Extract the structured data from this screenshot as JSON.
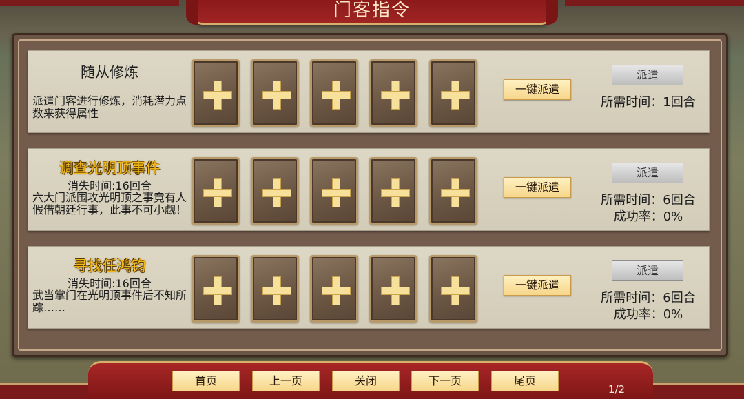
{
  "header": {
    "title": "门客指令"
  },
  "missions": [
    {
      "title": "随从修炼",
      "vanish_time": "",
      "description": "派遣门客进行修炼，消耗潜力点数来获得属性",
      "auto_dispatch_label": "一键派遣",
      "dispatch_label": "派遣",
      "required_time": "所需时间：1回合",
      "success_rate": ""
    },
    {
      "title": "调查光明顶事件",
      "vanish_time": "消失时间:16回合",
      "description": "六大门派围攻光明顶之事竟有人假借朝廷行事，此事不可小觑！",
      "auto_dispatch_label": "一键派遣",
      "dispatch_label": "派遣",
      "required_time": "所需时间：6回合",
      "success_rate": "成功率：0%"
    },
    {
      "title": "寻找任鸿钧",
      "vanish_time": "消失时间:16回合",
      "description": "武当掌门在光明顶事件后不知所踪……",
      "auto_dispatch_label": "一键派遣",
      "dispatch_label": "派遣",
      "required_time": "所需时间：6回合",
      "success_rate": "成功率：0%"
    }
  ],
  "slot_icon": "plus-icon",
  "footer": {
    "first_label": "首页",
    "prev_label": "上一页",
    "close_label": "关闭",
    "next_label": "下一页",
    "last_label": "尾页",
    "page_indicator": "1/2"
  },
  "colors": {
    "title_bar": "#a02424",
    "row_bg": "#ddd7c5",
    "gold_title": "#f2b81a",
    "button_bg": "#f6d68a",
    "dispatch_disabled": "#bdbdbd"
  }
}
